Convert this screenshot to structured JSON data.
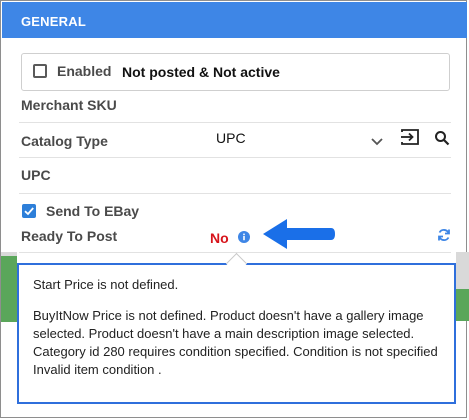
{
  "header": {
    "title": "GENERAL"
  },
  "fields": {
    "enabled": {
      "label": "Enabled",
      "checked": false,
      "status": "Not posted & Not active"
    },
    "merchant_sku": {
      "label": "Merchant SKU"
    },
    "catalog_type": {
      "label": "Catalog Type",
      "value": "UPC"
    },
    "upc": {
      "label": "UPC"
    },
    "send_to_ebay": {
      "label": "Send To EBay",
      "checked": true
    },
    "ready_to_post": {
      "label": "Ready To Post",
      "value": "No"
    }
  },
  "tooltip": {
    "line1": "Start Price is not defined.",
    "line2": "BuyItNow Price is not defined. Product doesn't have a gallery image selected. Product doesn't have a main description image selected. Category id 280 requires condition specified. Condition is not specified Invalid item condition ."
  },
  "colors": {
    "header": "#3e86e6",
    "no_value": "#d7141b",
    "annotation_arrow": "#1a6fe8",
    "tooltip_border": "#2f6fdc",
    "checkbox_checked": "#2d7fd9"
  },
  "icons": [
    "chevron-down-icon",
    "enter-icon",
    "search-icon",
    "info-icon",
    "refresh-icon",
    "arrow-left-icon"
  ]
}
